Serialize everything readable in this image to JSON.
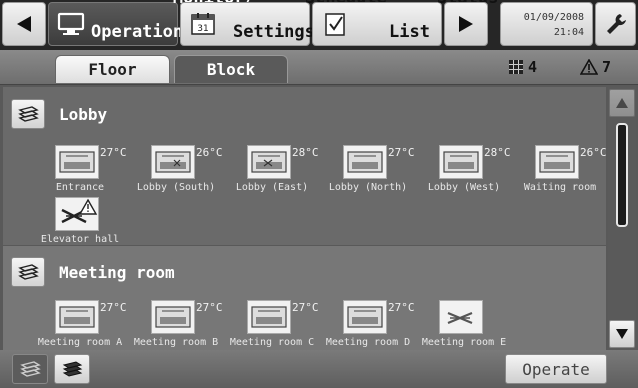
{
  "topbar": {
    "monitor_label_1": "Monitor/",
    "monitor_label_2": "Operation",
    "schedule_label_1": "Schedule",
    "schedule_label_2": "Settings",
    "status_label_1": "Status",
    "status_label_2": "List",
    "date": "01/09/2008",
    "time": "21:04",
    "icons": [
      "back-arrow-icon",
      "monitor-icon",
      "calendar-icon",
      "clipboard-icon",
      "forward-arrow-icon",
      "wrench-icon"
    ]
  },
  "tabs": {
    "floor": "Floor",
    "block": "Block"
  },
  "counts": {
    "units_count": "4",
    "warning_count": "7",
    "icons": [
      "grid-units-icon",
      "warning-triangle-icon"
    ]
  },
  "groups": [
    {
      "name": "Lobby",
      "units": [
        {
          "name": "Entrance",
          "temp": "27°C",
          "state": "normal"
        },
        {
          "name": "Lobby (South)",
          "temp": "26°C",
          "state": "normal"
        },
        {
          "name": "Lobby (East)",
          "temp": "28°C",
          "state": "normal"
        },
        {
          "name": "Lobby (North)",
          "temp": "27°C",
          "state": "normal"
        },
        {
          "name": "Lobby (West)",
          "temp": "28°C",
          "state": "normal"
        },
        {
          "name": "Waiting room",
          "temp": "26°C",
          "state": "normal"
        },
        {
          "name": "Elevator hall",
          "temp": "",
          "state": "error"
        }
      ]
    },
    {
      "name": "Meeting room",
      "units": [
        {
          "name": "Meeting room A",
          "temp": "27°C",
          "state": "normal"
        },
        {
          "name": "Meeting room B",
          "temp": "27°C",
          "state": "normal"
        },
        {
          "name": "Meeting room C",
          "temp": "27°C",
          "state": "normal"
        },
        {
          "name": "Meeting room D",
          "temp": "27°C",
          "state": "normal"
        },
        {
          "name": "Meeting room E",
          "temp": "",
          "state": "off"
        }
      ]
    }
  ],
  "bottombar": {
    "operate_label": "Operate"
  },
  "colors": {
    "dark_bar": "#262626",
    "panel": "#6a6a6a",
    "button_light": "#e6e6e6"
  }
}
